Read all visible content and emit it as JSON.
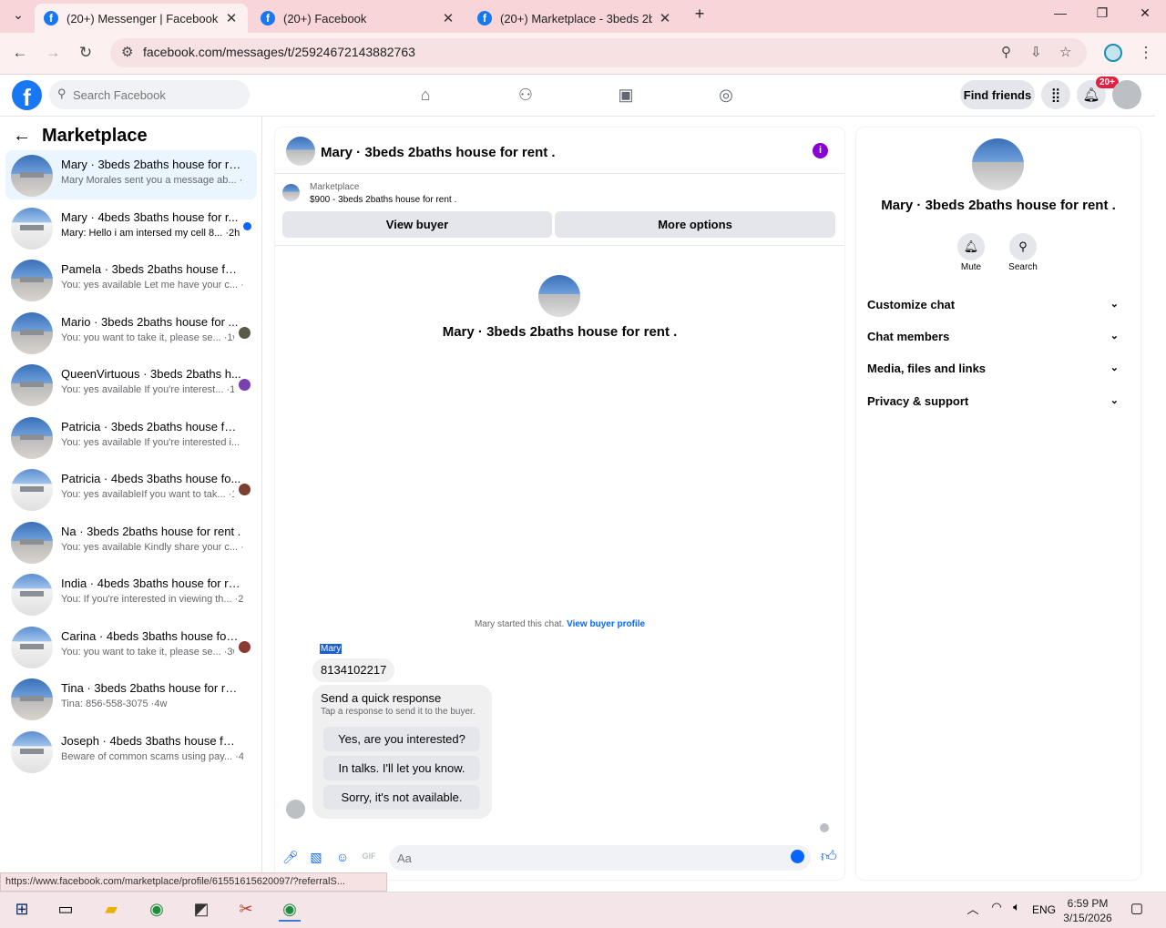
{
  "tabs": [
    {
      "title": "(20+) Messenger | Facebook",
      "active": true
    },
    {
      "title": "(20+) Facebook",
      "active": false
    },
    {
      "title": "(20+) Marketplace - 3beds 2ba",
      "active": false
    }
  ],
  "address_bar": {
    "url": "facebook.com/messages/t/25924672143882763"
  },
  "fb_header": {
    "search_placeholder": "Search Facebook",
    "find_friends": "Find friends",
    "notifications_badge": "20+"
  },
  "left_panel": {
    "title": "Marketplace",
    "conversations": [
      {
        "name": "Mary · 3beds 2baths house for rent .",
        "snippet": "Mary Morales sent you a message ab... ·2h",
        "selected": true
      },
      {
        "name": "Mary · 4beds 3baths house for r...",
        "snippet": "Mary: Hello i am intersed my cell 8... ·2h",
        "unread": true
      },
      {
        "name": "Pamela · 3beds 2baths house for r...",
        "snippet": "You: yes available Let me have your c... ·2d"
      },
      {
        "name": "Mario · 3beds 2baths house for ...",
        "snippet": "You: you want to take it, please se... ·1w"
      },
      {
        "name": "QueenVirtuous · 3beds 2baths h...",
        "snippet": "You: yes available If you're interest... ·1w"
      },
      {
        "name": "Patricia · 3beds 2baths house for r...",
        "snippet": "You: yes available If you're interested i... 1w"
      },
      {
        "name": "Patricia · 4beds 3baths house fo...",
        "snippet": "You: yes availableIf you want to tak... ·1w"
      },
      {
        "name": "Na · 3beds 2baths house for rent .",
        "snippet": "You: yes available Kindly share your c... ·2w"
      },
      {
        "name": "India · 4beds 3baths house for rent .",
        "snippet": "You: If you're interested in viewing th... ·2w"
      },
      {
        "name": "Carina · 4beds 3baths house for ...",
        "snippet": "You: you want to take it, please se... ·3w"
      },
      {
        "name": "Tina · 3beds 2baths house for rent .",
        "snippet": "Tina: 856-558-3075 ·4w"
      },
      {
        "name": "Joseph · 4beds 3baths house for r...",
        "snippet": "Beware of common scams using pay... ·4w"
      }
    ]
  },
  "chat": {
    "title": "Mary · 3beds 2baths house for rent .",
    "listing_source": "Marketplace",
    "listing_detail": "$900 - 3beds 2baths house for rent .",
    "view_buyer": "View buyer",
    "more_options": "More options",
    "profile_name": "Mary · 3beds 2baths house for rent .",
    "started_text": "Mary started this chat.",
    "view_buyer_profile": "View buyer profile",
    "sender": "Mary",
    "message": "8134102217",
    "quick_response_title": "Send a quick response",
    "quick_response_subtitle": "Tap a response to send it to the buyer.",
    "quick_responses": [
      "Yes, are you interested?",
      "In talks. I'll let you know.",
      "Sorry, it's not available."
    ],
    "composer_placeholder": "Aa"
  },
  "right_panel": {
    "name": "Mary · 3beds 2baths house for rent .",
    "mute": "Mute",
    "search": "Search",
    "sections": [
      "Customize chat",
      "Chat members",
      "Media, files and links",
      "Privacy & support"
    ]
  },
  "status_url": "https://www.facebook.com/marketplace/profile/61551615620097/?referralS...",
  "taskbar": {
    "language": "ENG",
    "time": "6:59 PM",
    "date": "3/15/2026"
  },
  "colors": {
    "fb_blue": "#1877f2",
    "messenger_blue": "#0866ff",
    "selected_bg": "#ebf5ff",
    "badge_red": "#e41e3f",
    "info_purple": "#8a00d4"
  }
}
